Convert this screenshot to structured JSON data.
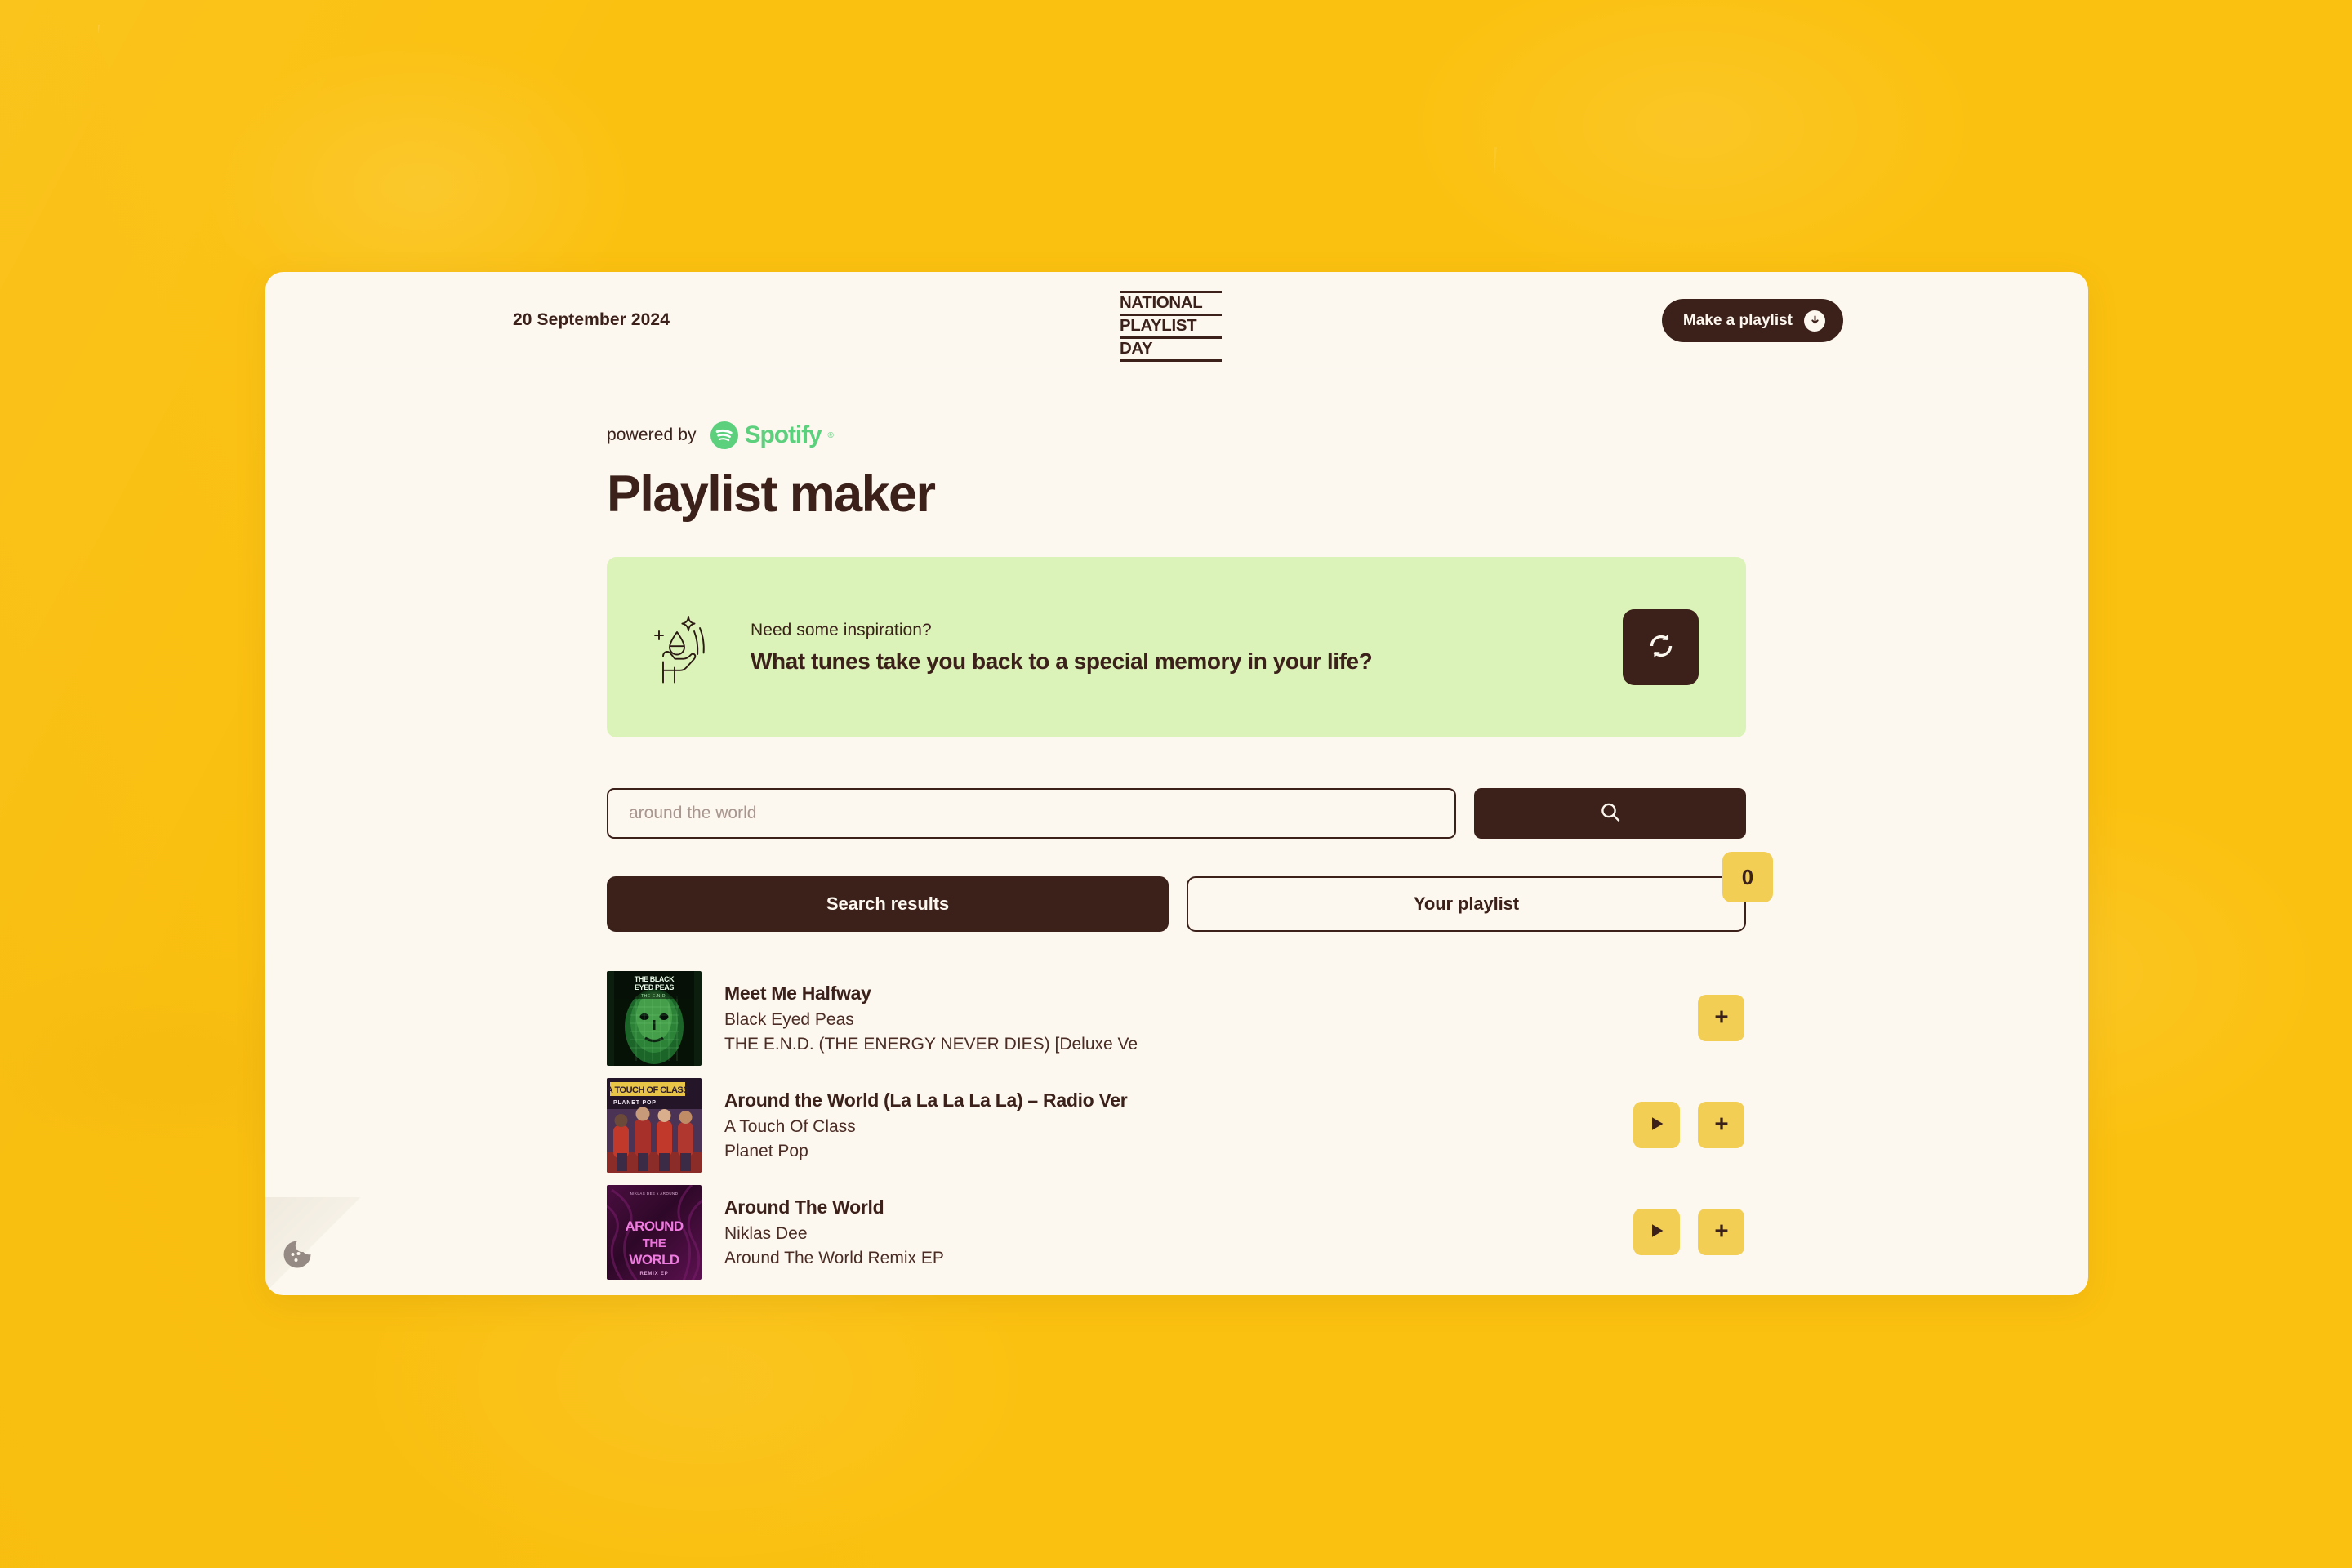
{
  "theme": {
    "page_background": "#FBC110",
    "card_background": "#FCF7EF",
    "ink": "#3B211A",
    "banner_green": "#DBF3B8",
    "accent_yellow": "#F2CE55",
    "spotify_green": "#5DD07E"
  },
  "header": {
    "date": "20 September 2024",
    "logo_lines": [
      "NATIONAL",
      "PLAYLIST",
      "DAY"
    ],
    "make_playlist_label": "Make a playlist",
    "download_icon": "download-arrow-icon"
  },
  "main": {
    "powered_by_label": "powered by",
    "spotify_wordmark": "Spotify",
    "spotify_registered": "®",
    "title": "Playlist maker"
  },
  "inspiration": {
    "icon": "hand-holding-idea-icon",
    "kicker": "Need some inspiration?",
    "question": "What tunes take you back to a special memory in your life?",
    "refresh_icon": "refresh-icon"
  },
  "search": {
    "placeholder": "around the world",
    "value": "",
    "submit_icon": "search-icon"
  },
  "tabs": {
    "search_results_label": "Search results",
    "your_playlist_label": "Your playlist",
    "playlist_count": "0",
    "active": "search_results"
  },
  "tracks": [
    {
      "title": "Meet Me Halfway",
      "artist": "Black Eyed Peas",
      "album": "THE E.N.D. (THE ENERGY NEVER DIES) [Deluxe Ve",
      "art": "black-eyed-peas-the-end",
      "art_colors": [
        "#0B1A0C",
        "#2E7D3A",
        "#68C96E"
      ],
      "has_preview": false,
      "play_icon": "play-icon",
      "add_icon": "plus-icon"
    },
    {
      "title": "Around the World (La La La La La) – Radio Ver",
      "artist": "A Touch Of Class",
      "album": "Planet Pop",
      "art": "a-touch-of-class-planet-pop",
      "art_colors": [
        "#2B1B30",
        "#C0392B",
        "#E8C547"
      ],
      "has_preview": true,
      "play_icon": "play-icon",
      "add_icon": "plus-icon"
    },
    {
      "title": "Around The World",
      "artist": "Niklas Dee",
      "album": "Around The World Remix EP",
      "art": "niklas-dee-around-the-world-remix-ep",
      "art_colors": [
        "#3A0B33",
        "#7A1466",
        "#E86CD6"
      ],
      "has_preview": true,
      "play_icon": "play-icon",
      "add_icon": "plus-icon"
    }
  ],
  "cookie": {
    "icon": "cookie-icon"
  }
}
